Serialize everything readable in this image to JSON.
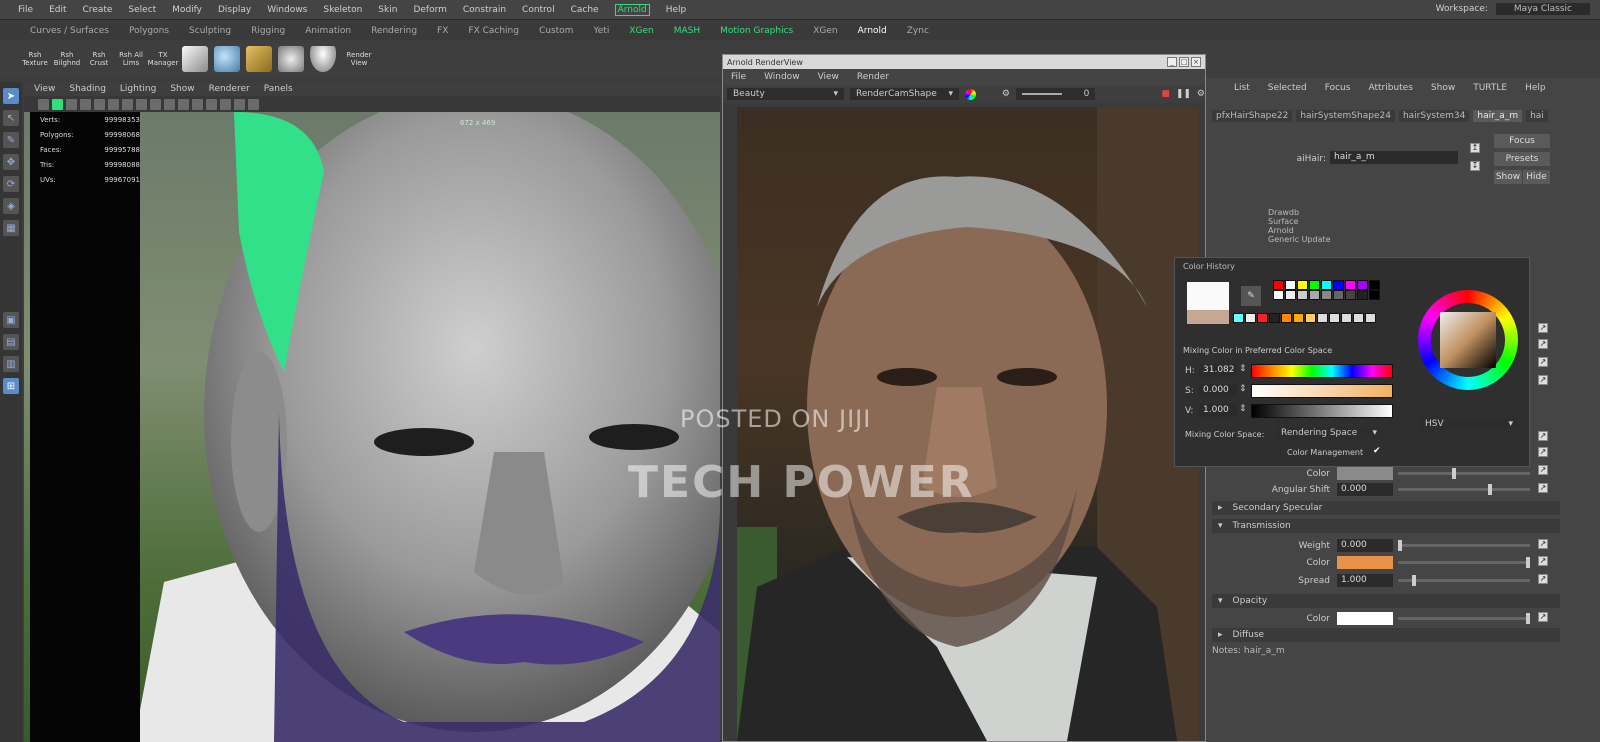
{
  "menubar": {
    "items": [
      "File",
      "Edit",
      "Create",
      "Select",
      "Modify",
      "Display",
      "Windows",
      "Skeleton",
      "Skin",
      "Deform",
      "Constrain",
      "Control",
      "Cache",
      "Arnold",
      "Help"
    ],
    "workspace_label": "Workspace:",
    "workspace_value": "Maya Classic"
  },
  "shelf": {
    "tabs": [
      "Curves / Surfaces",
      "Polygons",
      "Sculpting",
      "Rigging",
      "Animation",
      "Rendering",
      "FX",
      "FX Caching",
      "Custom",
      "Yeti",
      "XGen",
      "MASH",
      "Motion Graphics",
      "XGen",
      "Arnold",
      "Zync"
    ],
    "buttons": [
      "Rsh Texture",
      "Rsh Bilghnd",
      "Rsh Crust",
      "Rsh All Lims",
      "TX Manager",
      "",
      "",
      "",
      "",
      "",
      "Render View"
    ]
  },
  "viewport": {
    "menu": [
      "View",
      "Shading",
      "Lighting",
      "Show",
      "Renderer",
      "Panels"
    ],
    "resolution": "672 x 469",
    "hud": [
      {
        "label": "Verts:",
        "value": "99998353"
      },
      {
        "label": "Polygons:",
        "value": "99998068"
      },
      {
        "label": "Faces:",
        "value": "99995788"
      },
      {
        "label": "Tris:",
        "value": "99998088"
      },
      {
        "label": "UVs:",
        "value": "99967091"
      }
    ]
  },
  "render_view": {
    "title": "Arnold RenderView",
    "menu": [
      "File",
      "Window",
      "View",
      "Render"
    ],
    "aov": "Beauty",
    "camera": "RenderCamShape",
    "zoom": "0"
  },
  "attribute_editor": {
    "menu": [
      "List",
      "Selected",
      "Focus",
      "Attributes",
      "Show",
      "TURTLE",
      "Help"
    ],
    "tabs": [
      "pfxHairShape22",
      "hairSystemShape24",
      "hairSystem34",
      "hair_a_m",
      "hai"
    ],
    "name_label": "aiHair:",
    "name_value": "hair_a_m",
    "focus_label": "Focus",
    "presets_label": "Presets",
    "show_label": "Show",
    "hide_label": "Hide",
    "node_lines": [
      "Drawdb",
      "Surface",
      "Arnold",
      "Generic Update"
    ],
    "rows": [
      {
        "label": "Color",
        "value": ""
      },
      {
        "label": "Angular Shift",
        "value": "0.000"
      }
    ],
    "sections": [
      {
        "title": "Secondary Specular"
      },
      {
        "title": "Transmission"
      },
      {
        "title": "Opacity"
      },
      {
        "title": "Diffuse"
      }
    ],
    "transmission": [
      {
        "label": "Weight",
        "value": "0.000"
      },
      {
        "label": "Color",
        "value": ""
      },
      {
        "label": "Spread",
        "value": "1.000"
      }
    ],
    "opacity_color_label": "Color",
    "notes": "Notes: hair_a_m",
    "swatch_colors": {
      "transmission": "#e8924a",
      "opacity": "#ffffff"
    }
  },
  "color_popup": {
    "title": "Color History",
    "mixing_label": "Mixing Color in Preferred Color Space",
    "h_label": "H:",
    "h_value": "31.082",
    "s_label": "S:",
    "s_value": "0.000",
    "v_label": "V:",
    "v_value": "1.000",
    "space_label": "Mixing Color Space:",
    "space_value": "Rendering Space",
    "mgmt_label": "Color Management",
    "mode_value": "HSV"
  },
  "watermark": {
    "line1": "POSTED ON JIJI",
    "line2": "TECH POWER"
  }
}
